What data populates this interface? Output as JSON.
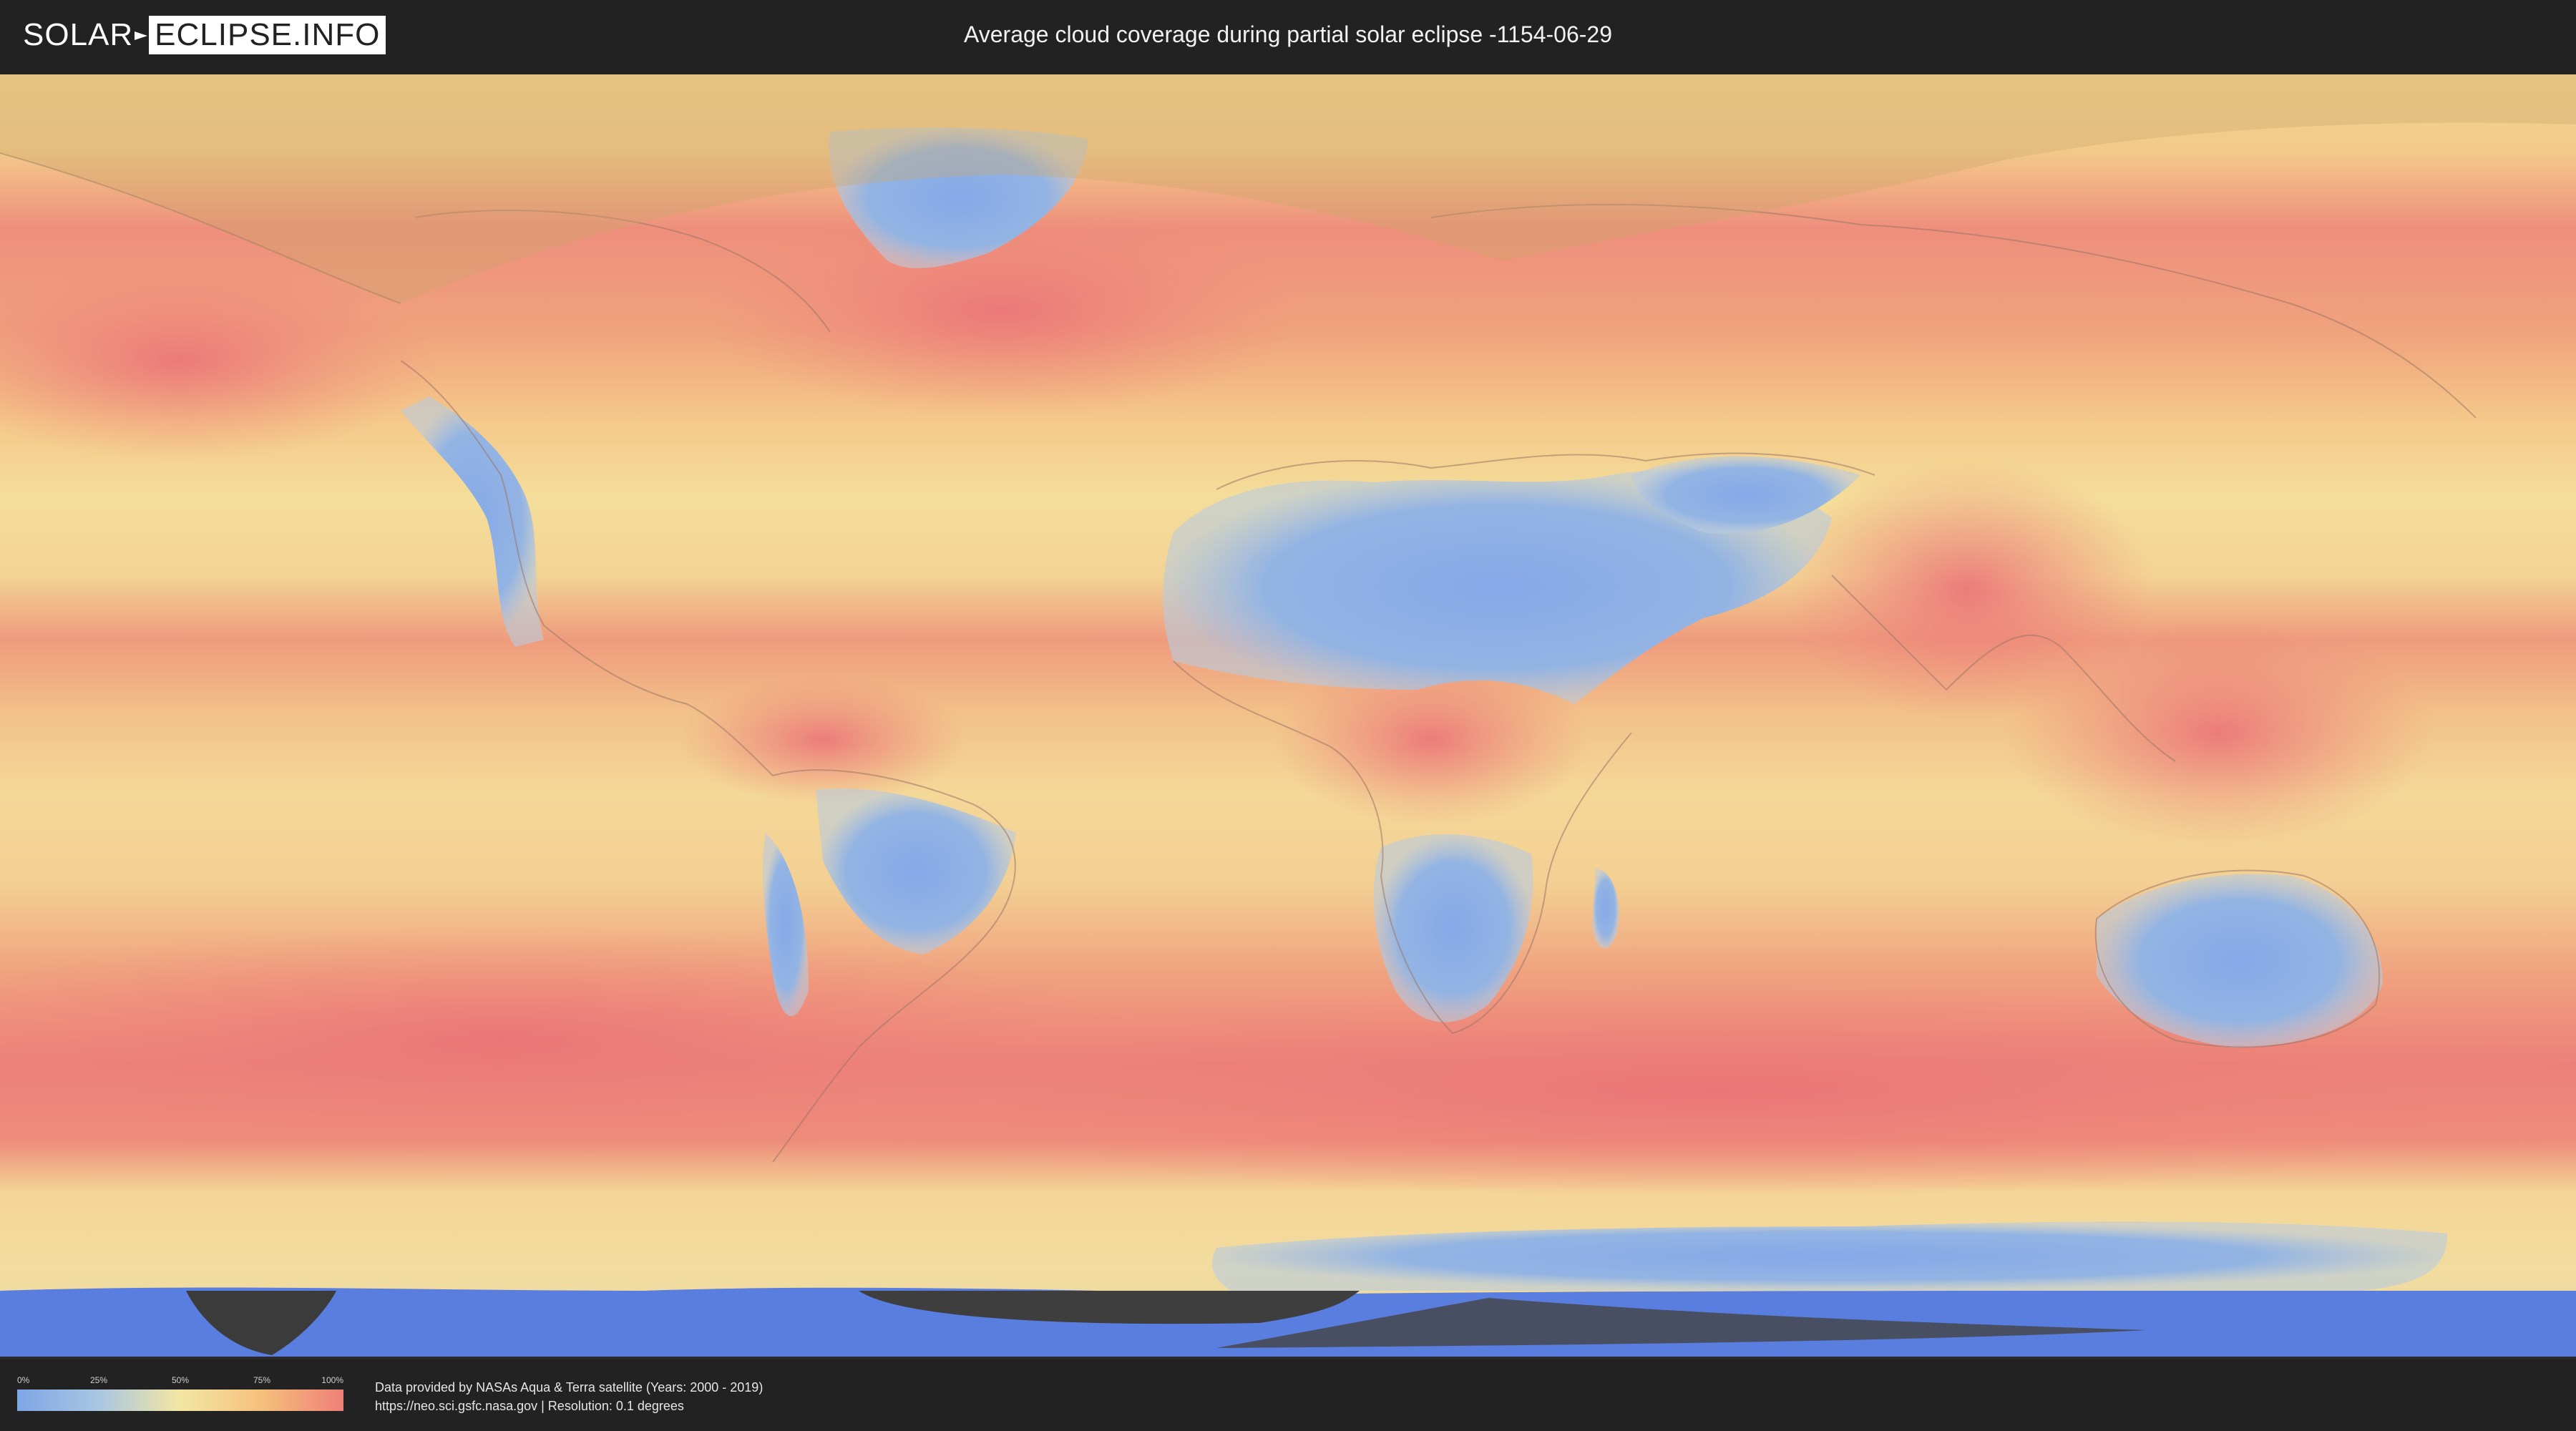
{
  "header": {
    "logo_left": "SOLAR",
    "logo_right": "ECLIPSE.INFO",
    "title": "Average cloud coverage during partial solar eclipse -1154-06-29"
  },
  "legend": {
    "ticks": [
      "0%",
      "25%",
      "50%",
      "75%",
      "100%"
    ],
    "values": [
      0,
      25,
      50,
      75,
      100
    ],
    "colors": [
      "#7ea6e6",
      "#a9c6e2",
      "#f4e6a4",
      "#f5c07c",
      "#ef7f78"
    ]
  },
  "credits": {
    "line1": "Data provided by NASAs Aqua & Terra satellite (Years: 2000 - 2019)",
    "line2": "https://neo.sci.gsfc.nasa.gov | Resolution: 0.1 degrees"
  },
  "colors": {
    "clear": "#7ea6e6",
    "partly": "#f3df9a",
    "cloudy": "#ef7e78",
    "background": "#222222",
    "ocean_blue": "#5a7ee0",
    "eclipse_shade": "#caa76a"
  }
}
